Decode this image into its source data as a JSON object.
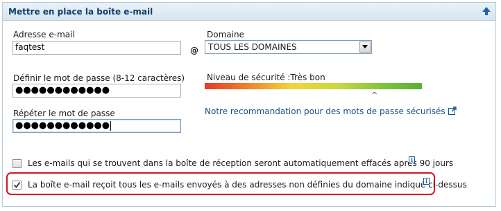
{
  "panel": {
    "title": "Mettre en place la boîte e-mail",
    "collapse_icon": "arrow-up-icon"
  },
  "form": {
    "email_label": "Adresse e-mail",
    "email_value": "faqtest",
    "at_sign": "@",
    "domain_label": "Domaine",
    "domain_value": "TOUS LES DOMAINES",
    "password_label": "Définir le mot de passe (8-12 caractères)",
    "password_value": "●●●●●●●●●●●●",
    "repeat_label": "Répéter le mot de passe",
    "repeat_value": "●●●●●●●●●●●●",
    "strength_label": "Niveau de sécurité :Très bon",
    "strength_marker": "^",
    "strength_level": 0.78,
    "recommendation_link": "Notre recommandation pour des mots de passe sécurisés"
  },
  "options": [
    {
      "label": "Les e-mails qui se trouvent dans la boîte de réception seront automatiquement effacés après 90 jours",
      "checked": false
    },
    {
      "label": "La boîte e-mail reçoit tous les e-mails envoyés à des adresses non définies du domaine indiqué ci-dessus",
      "checked": true
    }
  ],
  "colors": {
    "header_text": "#0b3f6e",
    "link": "#17508c",
    "highlight": "#d8121b"
  }
}
